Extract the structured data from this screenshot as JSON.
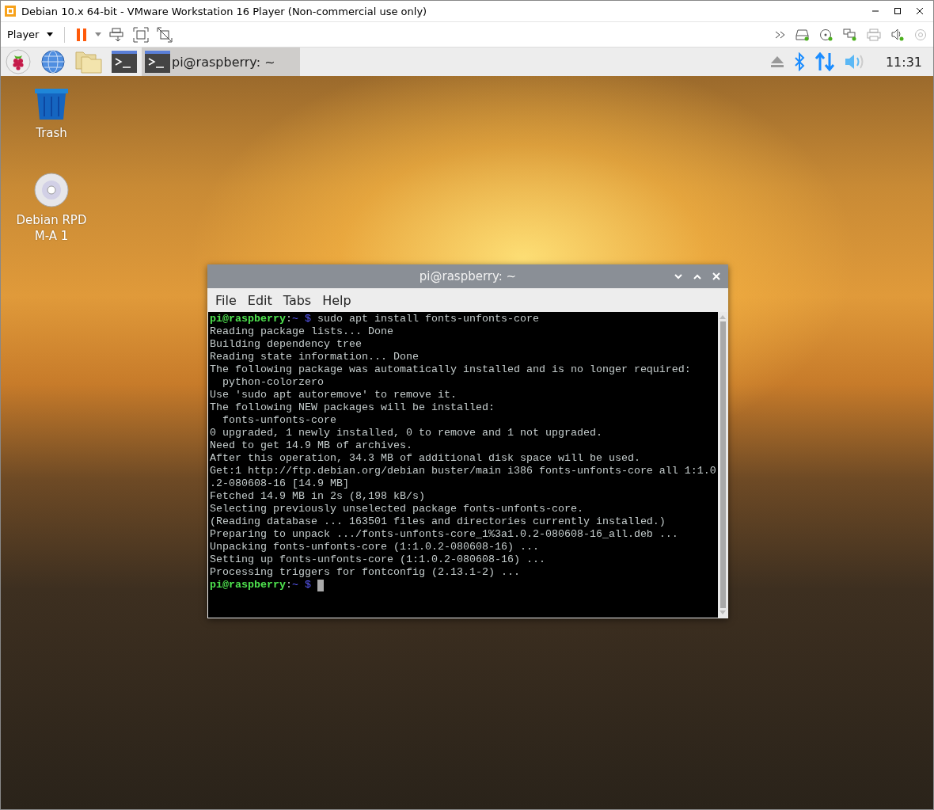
{
  "vm_window": {
    "title": "Debian 10.x 64-bit - VMware Workstation 16 Player (Non-commercial use only)"
  },
  "vm_toolbar": {
    "player_menu": "Player"
  },
  "taskbar": {
    "tasks": [
      {
        "label": "pi@raspberry: ~",
        "selected": true
      }
    ],
    "clock": "11:31"
  },
  "desktop_icons": [
    {
      "label": "Trash",
      "kind": "trash"
    },
    {
      "label": "Debian RPD M-A 1",
      "kind": "disc"
    }
  ],
  "terminal": {
    "title": "pi@raspberry: ~",
    "menu": [
      "File",
      "Edit",
      "Tabs",
      "Help"
    ],
    "lines": [
      {
        "kind": "prompt",
        "user": "pi@raspberry",
        "separator": ":",
        "path": "~",
        "symbol": "$",
        "command": "sudo apt install fonts-unfonts-core",
        "cursor": false
      },
      {
        "kind": "output",
        "text": "Reading package lists... Done"
      },
      {
        "kind": "output",
        "text": "Building dependency tree"
      },
      {
        "kind": "output",
        "text": "Reading state information... Done"
      },
      {
        "kind": "output",
        "text": "The following package was automatically installed and is no longer required:"
      },
      {
        "kind": "output",
        "text": "  python-colorzero"
      },
      {
        "kind": "output",
        "text": "Use 'sudo apt autoremove' to remove it."
      },
      {
        "kind": "output",
        "text": "The following NEW packages will be installed:"
      },
      {
        "kind": "output",
        "text": "  fonts-unfonts-core"
      },
      {
        "kind": "output",
        "text": "0 upgraded, 1 newly installed, 0 to remove and 1 not upgraded."
      },
      {
        "kind": "output",
        "text": "Need to get 14.9 MB of archives."
      },
      {
        "kind": "output",
        "text": "After this operation, 34.3 MB of additional disk space will be used."
      },
      {
        "kind": "output",
        "text": "Get:1 http://ftp.debian.org/debian buster/main i386 fonts-unfonts-core all 1:1.0"
      },
      {
        "kind": "output",
        "text": ".2-080608-16 [14.9 MB]"
      },
      {
        "kind": "output",
        "text": "Fetched 14.9 MB in 2s (8,198 kB/s)"
      },
      {
        "kind": "output",
        "text": "Selecting previously unselected package fonts-unfonts-core."
      },
      {
        "kind": "output",
        "text": "(Reading database ... 163501 files and directories currently installed.)"
      },
      {
        "kind": "output",
        "text": "Preparing to unpack .../fonts-unfonts-core_1%3a1.0.2-080608-16_all.deb ..."
      },
      {
        "kind": "output",
        "text": "Unpacking fonts-unfonts-core (1:1.0.2-080608-16) ..."
      },
      {
        "kind": "output",
        "text": "Setting up fonts-unfonts-core (1:1.0.2-080608-16) ..."
      },
      {
        "kind": "output",
        "text": "Processing triggers for fontconfig (2.13.1-2) ..."
      },
      {
        "kind": "prompt",
        "user": "pi@raspberry",
        "separator": ":",
        "path": "~",
        "symbol": "$",
        "cursor": true
      }
    ]
  }
}
